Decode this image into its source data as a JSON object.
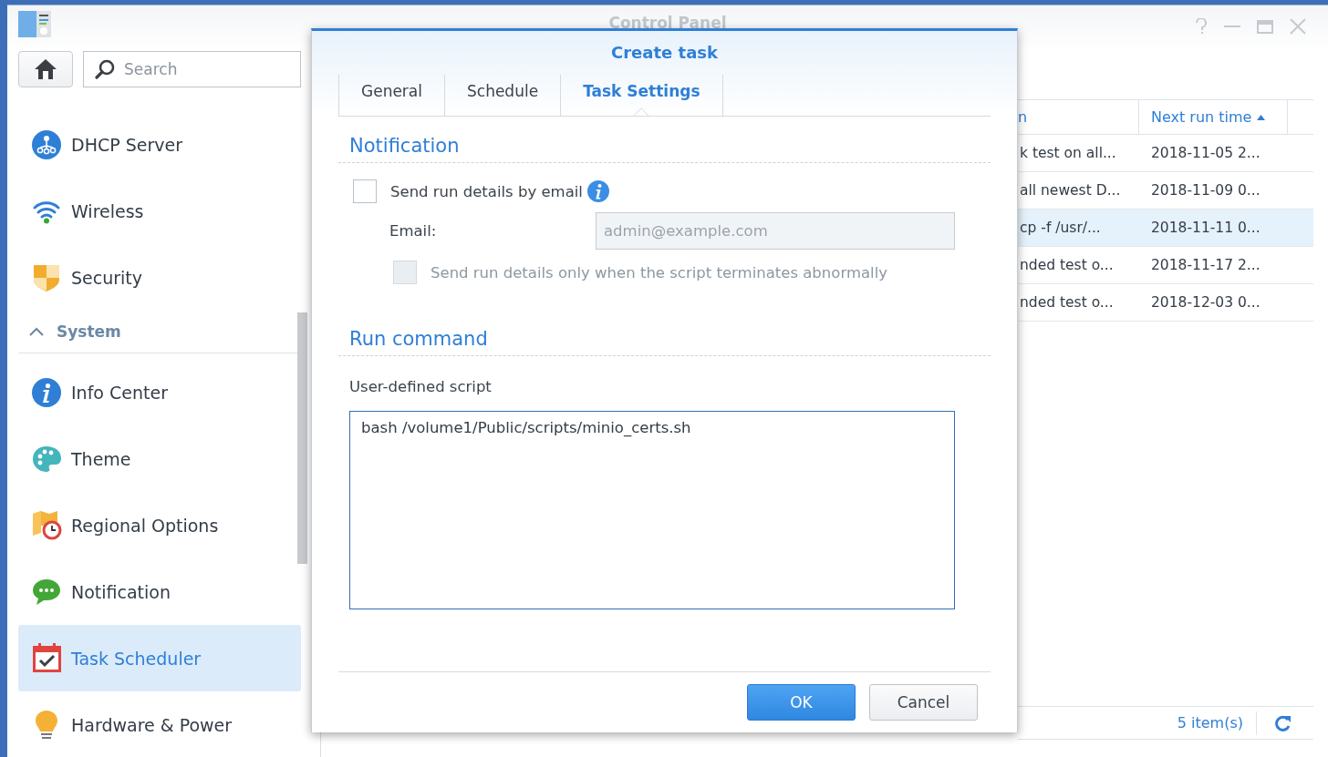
{
  "window": {
    "title": "Control Panel"
  },
  "sidebar": {
    "search": {
      "placeholder": "Search"
    },
    "items": [
      {
        "kind": "item",
        "label": "DHCP Server",
        "selected": false
      },
      {
        "kind": "item",
        "label": "Wireless",
        "selected": false
      },
      {
        "kind": "item",
        "label": "Security",
        "selected": false
      },
      {
        "kind": "group",
        "label": "System",
        "expanded": true
      },
      {
        "kind": "item",
        "label": "Info Center",
        "selected": false
      },
      {
        "kind": "item",
        "label": "Theme",
        "selected": false
      },
      {
        "kind": "item",
        "label": "Regional Options",
        "selected": false
      },
      {
        "kind": "item",
        "label": "Notification",
        "selected": false
      },
      {
        "kind": "item",
        "label": "Task Scheduler",
        "selected": true
      },
      {
        "kind": "item",
        "label": "Hardware & Power",
        "selected": false
      }
    ]
  },
  "table": {
    "columns": [
      {
        "label": "n",
        "sorted": false
      },
      {
        "label": "Next run time",
        "sorted": true
      }
    ],
    "rows": [
      {
        "cells": [
          "k test on all...",
          "2018-11-05 2..."
        ],
        "selected": false
      },
      {
        "cells": [
          "all newest D...",
          "2018-11-09 0..."
        ],
        "selected": false
      },
      {
        "cells": [
          "cp -f /usr/...",
          "2018-11-11 0..."
        ],
        "selected": true
      },
      {
        "cells": [
          "nded test o...",
          "2018-11-17 2..."
        ],
        "selected": false
      },
      {
        "cells": [
          "nded test o...",
          "2018-12-03 0..."
        ],
        "selected": false
      }
    ]
  },
  "status_bar": {
    "count": "5 item(s)"
  },
  "dialog": {
    "title": "Create task",
    "tabs": [
      {
        "label": "General",
        "selected": false
      },
      {
        "label": "Schedule",
        "selected": false
      },
      {
        "label": "Task Settings",
        "selected": true
      }
    ],
    "notification": {
      "heading": "Notification",
      "email_checkbox": {
        "label": "Send run details by email",
        "checked": false
      },
      "email": {
        "label": "Email:",
        "placeholder": "admin@example.com",
        "disabled": true
      },
      "abnormal_checkbox": {
        "label": "Send run details only when the script terminates abnormally",
        "checked": false,
        "disabled": true
      }
    },
    "run_command": {
      "heading": "Run command",
      "label": "User-defined script",
      "value": "bash /volume1/Public/scripts/minio_certs.sh"
    },
    "buttons": [
      {
        "label": "OK",
        "kind": "primary"
      },
      {
        "label": "Cancel",
        "kind": "secondary"
      }
    ]
  }
}
